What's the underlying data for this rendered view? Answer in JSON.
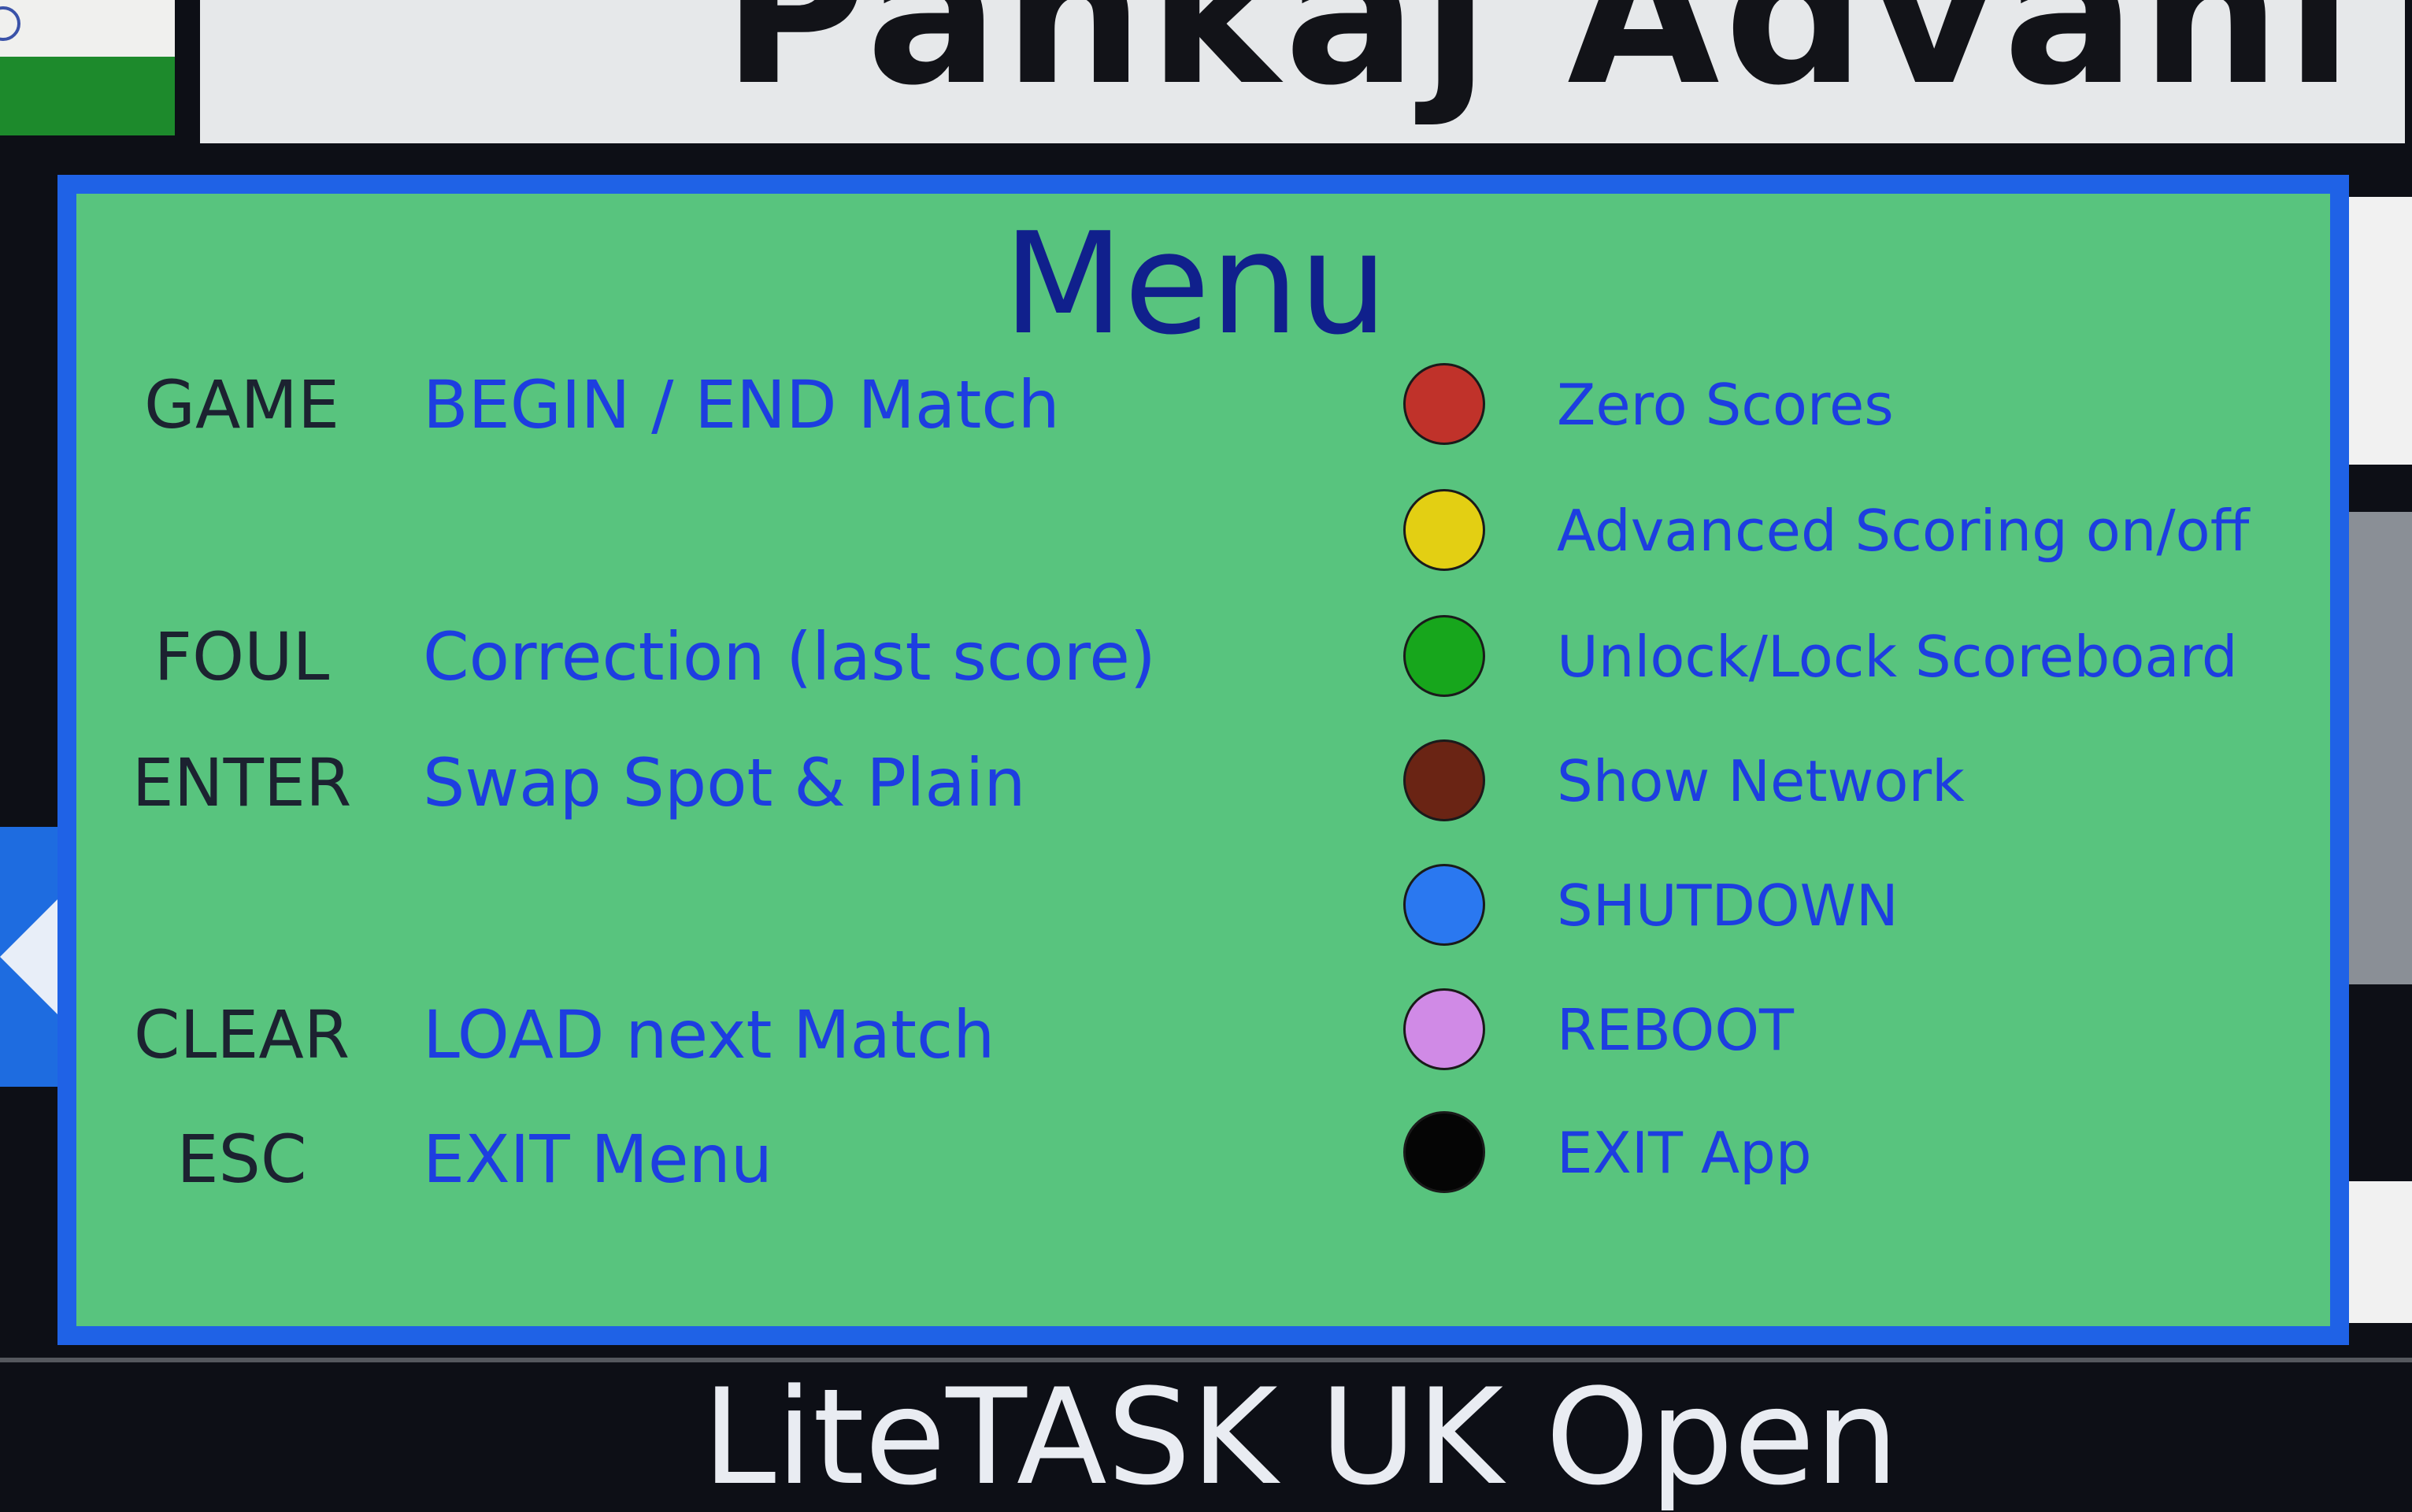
{
  "player": {
    "name": "Pankaj Advani"
  },
  "menu": {
    "title": "Menu",
    "keys": [
      {
        "key": "GAME",
        "action": "BEGIN / END Match"
      },
      {
        "key": "FOUL",
        "action": "Correction (last score)"
      },
      {
        "key": "ENTER",
        "action": "Swap Spot & Plain"
      },
      {
        "key": "CLEAR",
        "action": "LOAD next Match"
      },
      {
        "key": "ESC",
        "action": "EXIT Menu"
      }
    ],
    "options": [
      {
        "label": "Zero Scores",
        "color": "#c0322a"
      },
      {
        "label": "Advanced Scoring on/off",
        "color": "#e3cf13"
      },
      {
        "label": "Unlock/Lock Scoreboard",
        "color": "#17a61c"
      },
      {
        "label": "Show Network",
        "color": "#6a2414"
      },
      {
        "label": "SHUTDOWN",
        "color": "#2a78f0"
      },
      {
        "label": "REBOOT",
        "color": "#d08ae6"
      },
      {
        "label": "EXIT App",
        "color": "#050505"
      }
    ]
  },
  "footer": {
    "event": "LiteTASK UK Open"
  },
  "colors": {
    "panel_background": "#58c47e",
    "panel_border": "#1f62e6",
    "title": "#10208c",
    "action_text": "#1d3ee0",
    "key_text": "#1c2230"
  }
}
